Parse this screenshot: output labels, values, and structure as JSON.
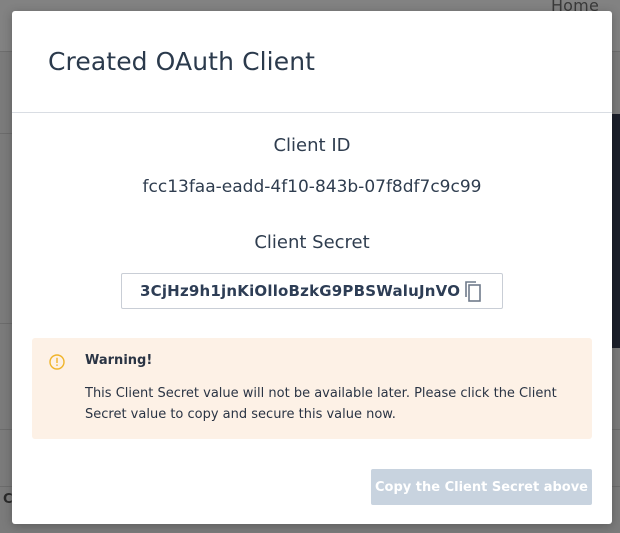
{
  "background": {
    "nav_home": "Home",
    "bottom_text": "C"
  },
  "modal": {
    "title": "Created OAuth Client",
    "client_id_label": "Client ID",
    "client_id_value": "fcc13faa-eadd-4f10-843b-07f8df7c9c99",
    "client_secret_label": "Client Secret",
    "client_secret_value": "3CjHz9h1jnKiOlloBzkG9PBSWaluJnVO",
    "copy_icon": "copy-icon",
    "warning": {
      "icon": "warning-icon",
      "title": "Warning!",
      "text": "This Client Secret value will not be available later. Please click the Client Secret value to copy and secure this value now."
    },
    "copy_button_label": "Copy the Client Secret above"
  },
  "colors": {
    "title": "#2b3a4c",
    "warning_bg": "#fdf1e6",
    "warning_icon": "#f0b429",
    "button_disabled_bg": "#c8d3df"
  }
}
